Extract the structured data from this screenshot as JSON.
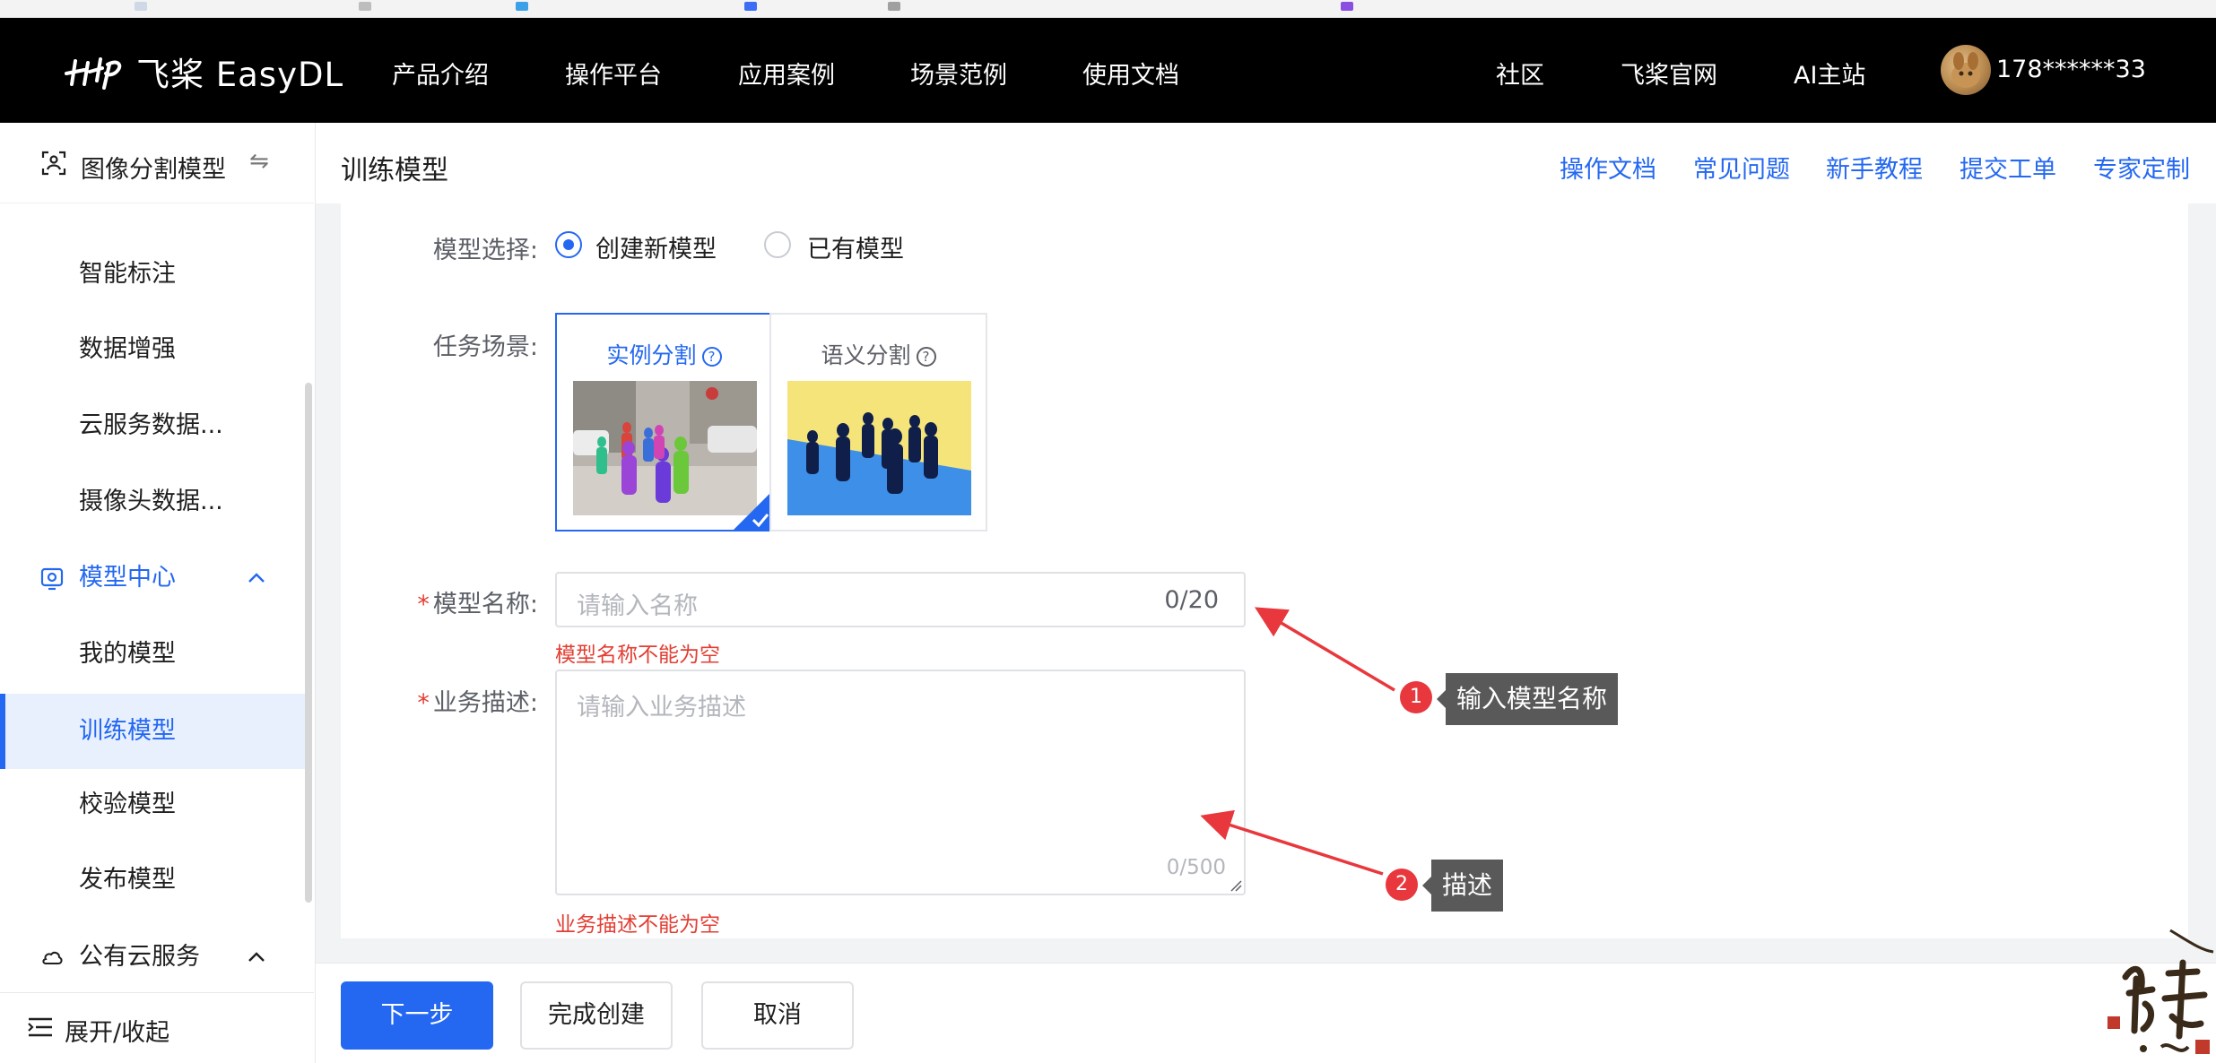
{
  "topnav": {
    "logo_text": "飞桨 EasyDL",
    "items": [
      "产品介绍",
      "操作平台",
      "应用案例",
      "场景范例",
      "使用文档"
    ],
    "right_items": [
      "社区",
      "飞桨官网",
      "AI主站"
    ],
    "user_name": "178******33"
  },
  "sidebar": {
    "header_label": "图像分割模型",
    "switch_glyph": "⇋",
    "items": [
      "智能标注",
      "数据增强",
      "云服务数据...",
      "摄像头数据..."
    ],
    "model_center": {
      "label": "模型中心",
      "items": [
        "我的模型",
        "训练模型",
        "校验模型",
        "发布模型"
      ],
      "active_item": "训练模型"
    },
    "cloud_service_label": "公有云服务",
    "footer_label": "展开/收起"
  },
  "header": {
    "title": "训练模型",
    "links": [
      "操作文档",
      "常见问题",
      "新手教程",
      "提交工单",
      "专家定制"
    ]
  },
  "form": {
    "model_select": {
      "label": "模型选择:",
      "options": [
        "创建新模型",
        "已有模型"
      ],
      "selected": "创建新模型"
    },
    "task_scene": {
      "label": "任务场景:",
      "options": [
        {
          "title": "实例分割",
          "selected": true
        },
        {
          "title": "语义分割",
          "selected": false
        }
      ],
      "help_glyph": "?"
    },
    "model_name": {
      "label": "模型名称:",
      "placeholder": "请输入名称",
      "value": "",
      "counter": "0/20",
      "error": "模型名称不能为空"
    },
    "business_desc": {
      "label": "业务描述:",
      "placeholder": "请输入业务描述",
      "value": "",
      "counter": "0/500",
      "error": "业务描述不能为空"
    },
    "required_mark": "*"
  },
  "annotations": [
    {
      "badge": "1",
      "text": "输入模型名称"
    },
    {
      "badge": "2",
      "text": "描述"
    }
  ],
  "footer": {
    "next_label": "下一步",
    "finish_label": "完成创建",
    "cancel_label": "取消"
  },
  "colors": {
    "accent": "#2468f2",
    "error": "#e33e33",
    "nav_bg": "#000000",
    "annotation_red": "#e8383d",
    "annotation_tip": "#595959"
  }
}
